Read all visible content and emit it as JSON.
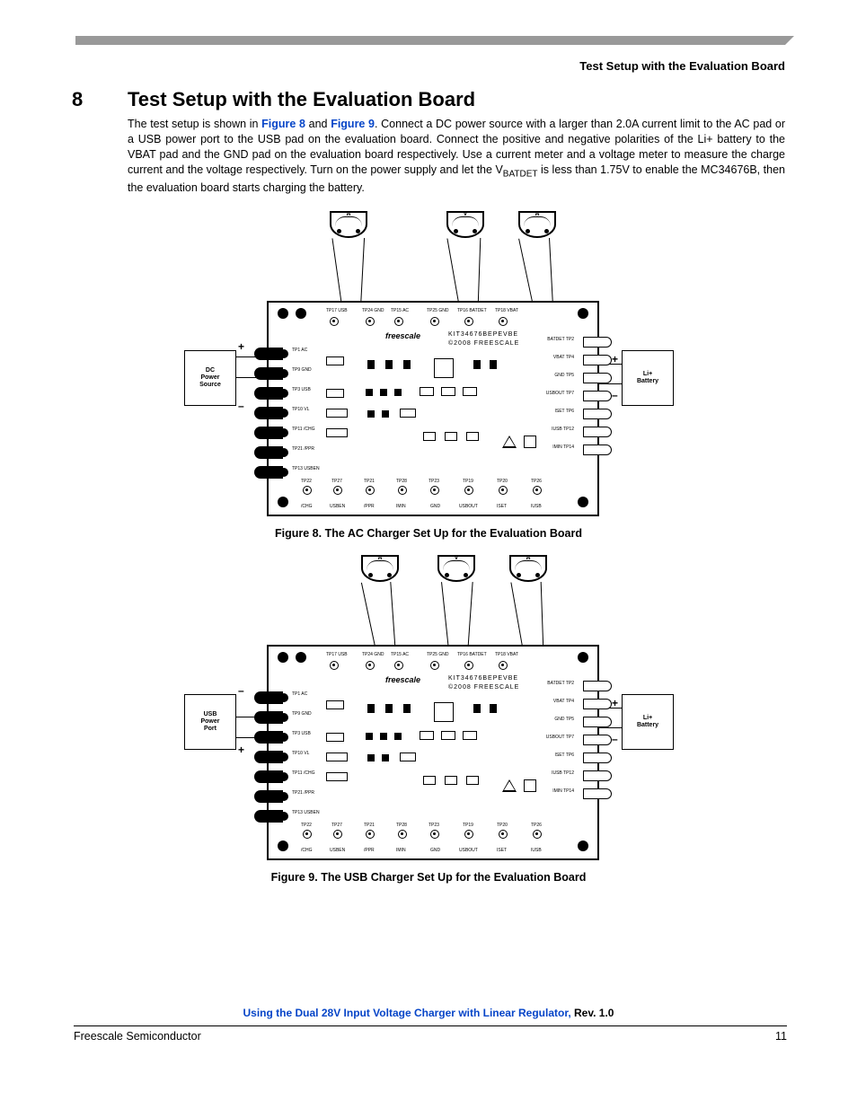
{
  "header": {
    "running_title": "Test Setup with the Evaluation Board"
  },
  "section": {
    "number": "8",
    "title": "Test Setup with the Evaluation Board"
  },
  "body": {
    "pre1": "The test setup is shown in ",
    "link1": "Figure 8",
    "mid1": " and ",
    "link2": "Figure 9",
    "post1": ". Connect a DC power source with a larger than 2.0A current limit to the AC pad or a USB power port to the USB pad on the evaluation board. Connect the positive and negative polarities of the Li+ battery to the VBAT pad and the GND pad on the evaluation board respectively. Use a current meter and a voltage meter to measure the charge current and the voltage respectively. Turn on the power supply and let the V",
    "sub1": "BATDET",
    "post2": " is less than 1.75V to enable the MC34676B, then the evaluation board starts charging the battery."
  },
  "fig8": {
    "caption": "Figure 8. The AC Charger Set Up for the Evaluation Board",
    "left_box": "DC\nPower\nSource",
    "left_top_sign": "+",
    "left_bot_sign": "–",
    "right_box": "Li+\nBattery",
    "right_top_sign": "+",
    "right_bot_sign": "–",
    "meter1": "A",
    "meter2": "V",
    "meter3": "A",
    "brand": "freescale",
    "brand2": "KIT34676BEPEVBE",
    "brand3": "©2008  FREESCALE",
    "tp_top": [
      "TP17 USB",
      "TP24 GND",
      "TP15 AC",
      "TP25 GND",
      "TP16 BATDET",
      "TP18 VBAT"
    ],
    "tp_bot": [
      "TP22",
      "TP27",
      "TP21",
      "TP28",
      "TP23",
      "TP19",
      "TP20",
      "TP26"
    ],
    "bot_labels": [
      "/CHG",
      "USBEN",
      "/PPR",
      "IMIN",
      "GND",
      "USBOUT",
      "ISET",
      "IUSB"
    ],
    "conn_left": [
      "TP1 AC",
      "TP9 GND",
      "TP3 USB",
      "TP10 VL",
      "TP11 /CHG",
      "TP21 /PPR",
      "TP13 USBEN"
    ],
    "conn_right": [
      "BATDET TP2",
      "VBAT TP4",
      "GND TP5",
      "USBOUT TP7",
      "ISET TP6",
      "IUSB TP12",
      "IMIN TP14"
    ]
  },
  "fig9": {
    "caption": "Figure 9. The USB Charger Set Up for the Evaluation Board",
    "left_box": "USB\nPower\nPort",
    "left_top_sign": "–",
    "left_bot_sign": "+",
    "right_box": "Li+\nBattery",
    "right_top_sign": "+",
    "right_bot_sign": "–",
    "meter1": "A",
    "meter2": "V",
    "meter3": "A",
    "brand": "freescale",
    "brand2": "KIT34676BEPEVBE",
    "brand3": "©2008  FREESCALE"
  },
  "footer": {
    "doc_title_blue": "Using the Dual 28V Input Voltage Charger with Linear Regulator,",
    "doc_title_black": " Rev. 1.0",
    "left": "Freescale Semiconductor",
    "right": "11"
  }
}
